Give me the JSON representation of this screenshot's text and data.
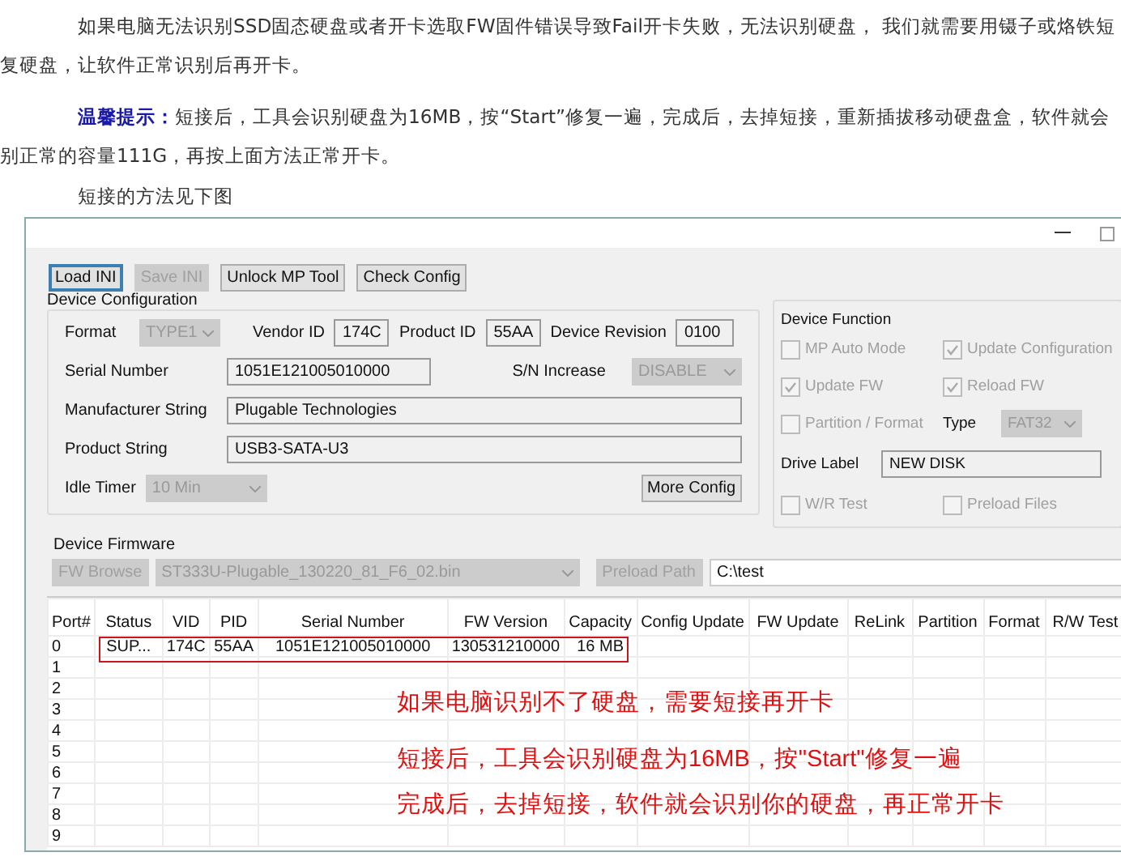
{
  "intro": {
    "lines": [
      "如果电脑无法识别SSD固态硬盘或者开卡选取FW固件错误导致Fail开卡失败，无法识别硬盘， 我们就需要用镊子或烙铁短",
      "复硬盘，让软件正常识别后再开卡。"
    ]
  },
  "tip": {
    "label": "温馨提示：",
    "lines": [
      "短接后，工具会识别硬盘为16MB，按“Start”修复一遍，完成后，去掉短接，重新插拔移动硬盘盒，软件就会",
      "别正常的容量111G，再按上面方法正常开卡。"
    ]
  },
  "caption": "短接的方法见下图",
  "window": {
    "toolbar": [
      {
        "label": "Load INI",
        "disabled": false,
        "focused": true
      },
      {
        "label": "Save INI",
        "disabled": true,
        "focused": false
      },
      {
        "label": "Unlock MP Tool",
        "disabled": false,
        "focused": false
      },
      {
        "label": "Check Config",
        "disabled": false,
        "focused": false
      }
    ],
    "device_configuration": {
      "title": "Device Configuration",
      "format": {
        "label": "Format",
        "value": "TYPE1",
        "disabled": true
      },
      "vendor_id": {
        "label": "Vendor ID",
        "value": "174C"
      },
      "product_id": {
        "label": "Product ID",
        "value": "55AA"
      },
      "device_revision": {
        "label": "Device Revision",
        "value": "0100"
      },
      "serial_number": {
        "label": "Serial Number",
        "value": "1051E121005010000"
      },
      "sn_increase": {
        "label": "S/N Increase",
        "value": "DISABLE",
        "disabled": true
      },
      "manufacturer_string": {
        "label": "Manufacturer String",
        "value": "Plugable Technologies"
      },
      "product_string": {
        "label": "Product String",
        "value": "USB3-SATA-U3"
      },
      "idle_timer": {
        "label": "Idle Timer",
        "value": "10 Min",
        "disabled": true
      },
      "more_button": "More Config"
    },
    "device_function": {
      "title": "Device Function",
      "options": [
        {
          "label": "MP Auto Mode",
          "checked": false,
          "disabled": true
        },
        {
          "label": "Update Configuration",
          "checked": true,
          "disabled": true
        },
        {
          "label": "Update FW",
          "checked": true,
          "disabled": true
        },
        {
          "label": "Reload FW",
          "checked": true,
          "disabled": true
        },
        {
          "label": "Partition / Format",
          "checked": false,
          "disabled": true
        }
      ],
      "type": {
        "label": "Type",
        "value": "FAT32",
        "disabled": true
      },
      "drive_label": {
        "label": "Drive Label",
        "value": "NEW DISK"
      },
      "extra_options": [
        {
          "label": "W/R Test",
          "checked": false,
          "disabled": true
        },
        {
          "label": "Preload Files",
          "checked": false,
          "disabled": true
        }
      ]
    },
    "device_firmware": {
      "title": "Device Firmware",
      "browse_button": "FW Browse",
      "file": "ST333U-Plugable_130220_81_F6_02.bin",
      "preload_button": "Preload Path",
      "preload_path": "C:\\test"
    },
    "table": {
      "columns": [
        "Port#",
        "Status",
        "VID",
        "PID",
        "Serial Number",
        "FW Version",
        "Capacity",
        "Config Update",
        "FW Update",
        "ReLink",
        "Partition",
        "Format",
        "R/W Test"
      ],
      "rows": [
        {
          "cells": [
            "0",
            "SUP...",
            "174C",
            "55AA",
            "1051E121005010000",
            "130531210000",
            "16 MB"
          ]
        },
        {
          "cells": [
            "1"
          ]
        },
        {
          "cells": [
            "2"
          ]
        },
        {
          "cells": [
            "3"
          ]
        },
        {
          "cells": [
            "4"
          ]
        },
        {
          "cells": [
            "5"
          ]
        },
        {
          "cells": [
            "6"
          ]
        },
        {
          "cells": [
            "7"
          ]
        },
        {
          "cells": [
            "8"
          ]
        },
        {
          "cells": [
            "9"
          ]
        }
      ]
    },
    "annotations": [
      "如果电脑识别不了硬盘，需要短接再开卡",
      "短接后，工具会识别硬盘为16MB，按\"Start\"修复一遍",
      "完成后，去掉短接，软件就会识别你的硬盘，再正常开卡"
    ]
  }
}
